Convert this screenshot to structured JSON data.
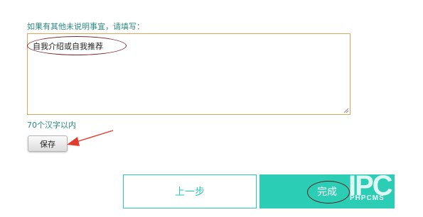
{
  "form": {
    "prompt_label": "如果有其他未说明事宜，请填写：",
    "textarea_value": "自我介绍或自我推荐",
    "char_limit_note": "70个汉字以内",
    "save_label": "保存"
  },
  "nav": {
    "prev_label": "上一步",
    "finish_label": "完成"
  },
  "watermark": {
    "text": "PHPCMS"
  },
  "colors": {
    "accent": "#2ccdb5",
    "label_text": "#2a8a7f",
    "textarea_border": "#d6a85a",
    "annotation": "#7b2a2a",
    "arrow": "#e03b2e"
  }
}
